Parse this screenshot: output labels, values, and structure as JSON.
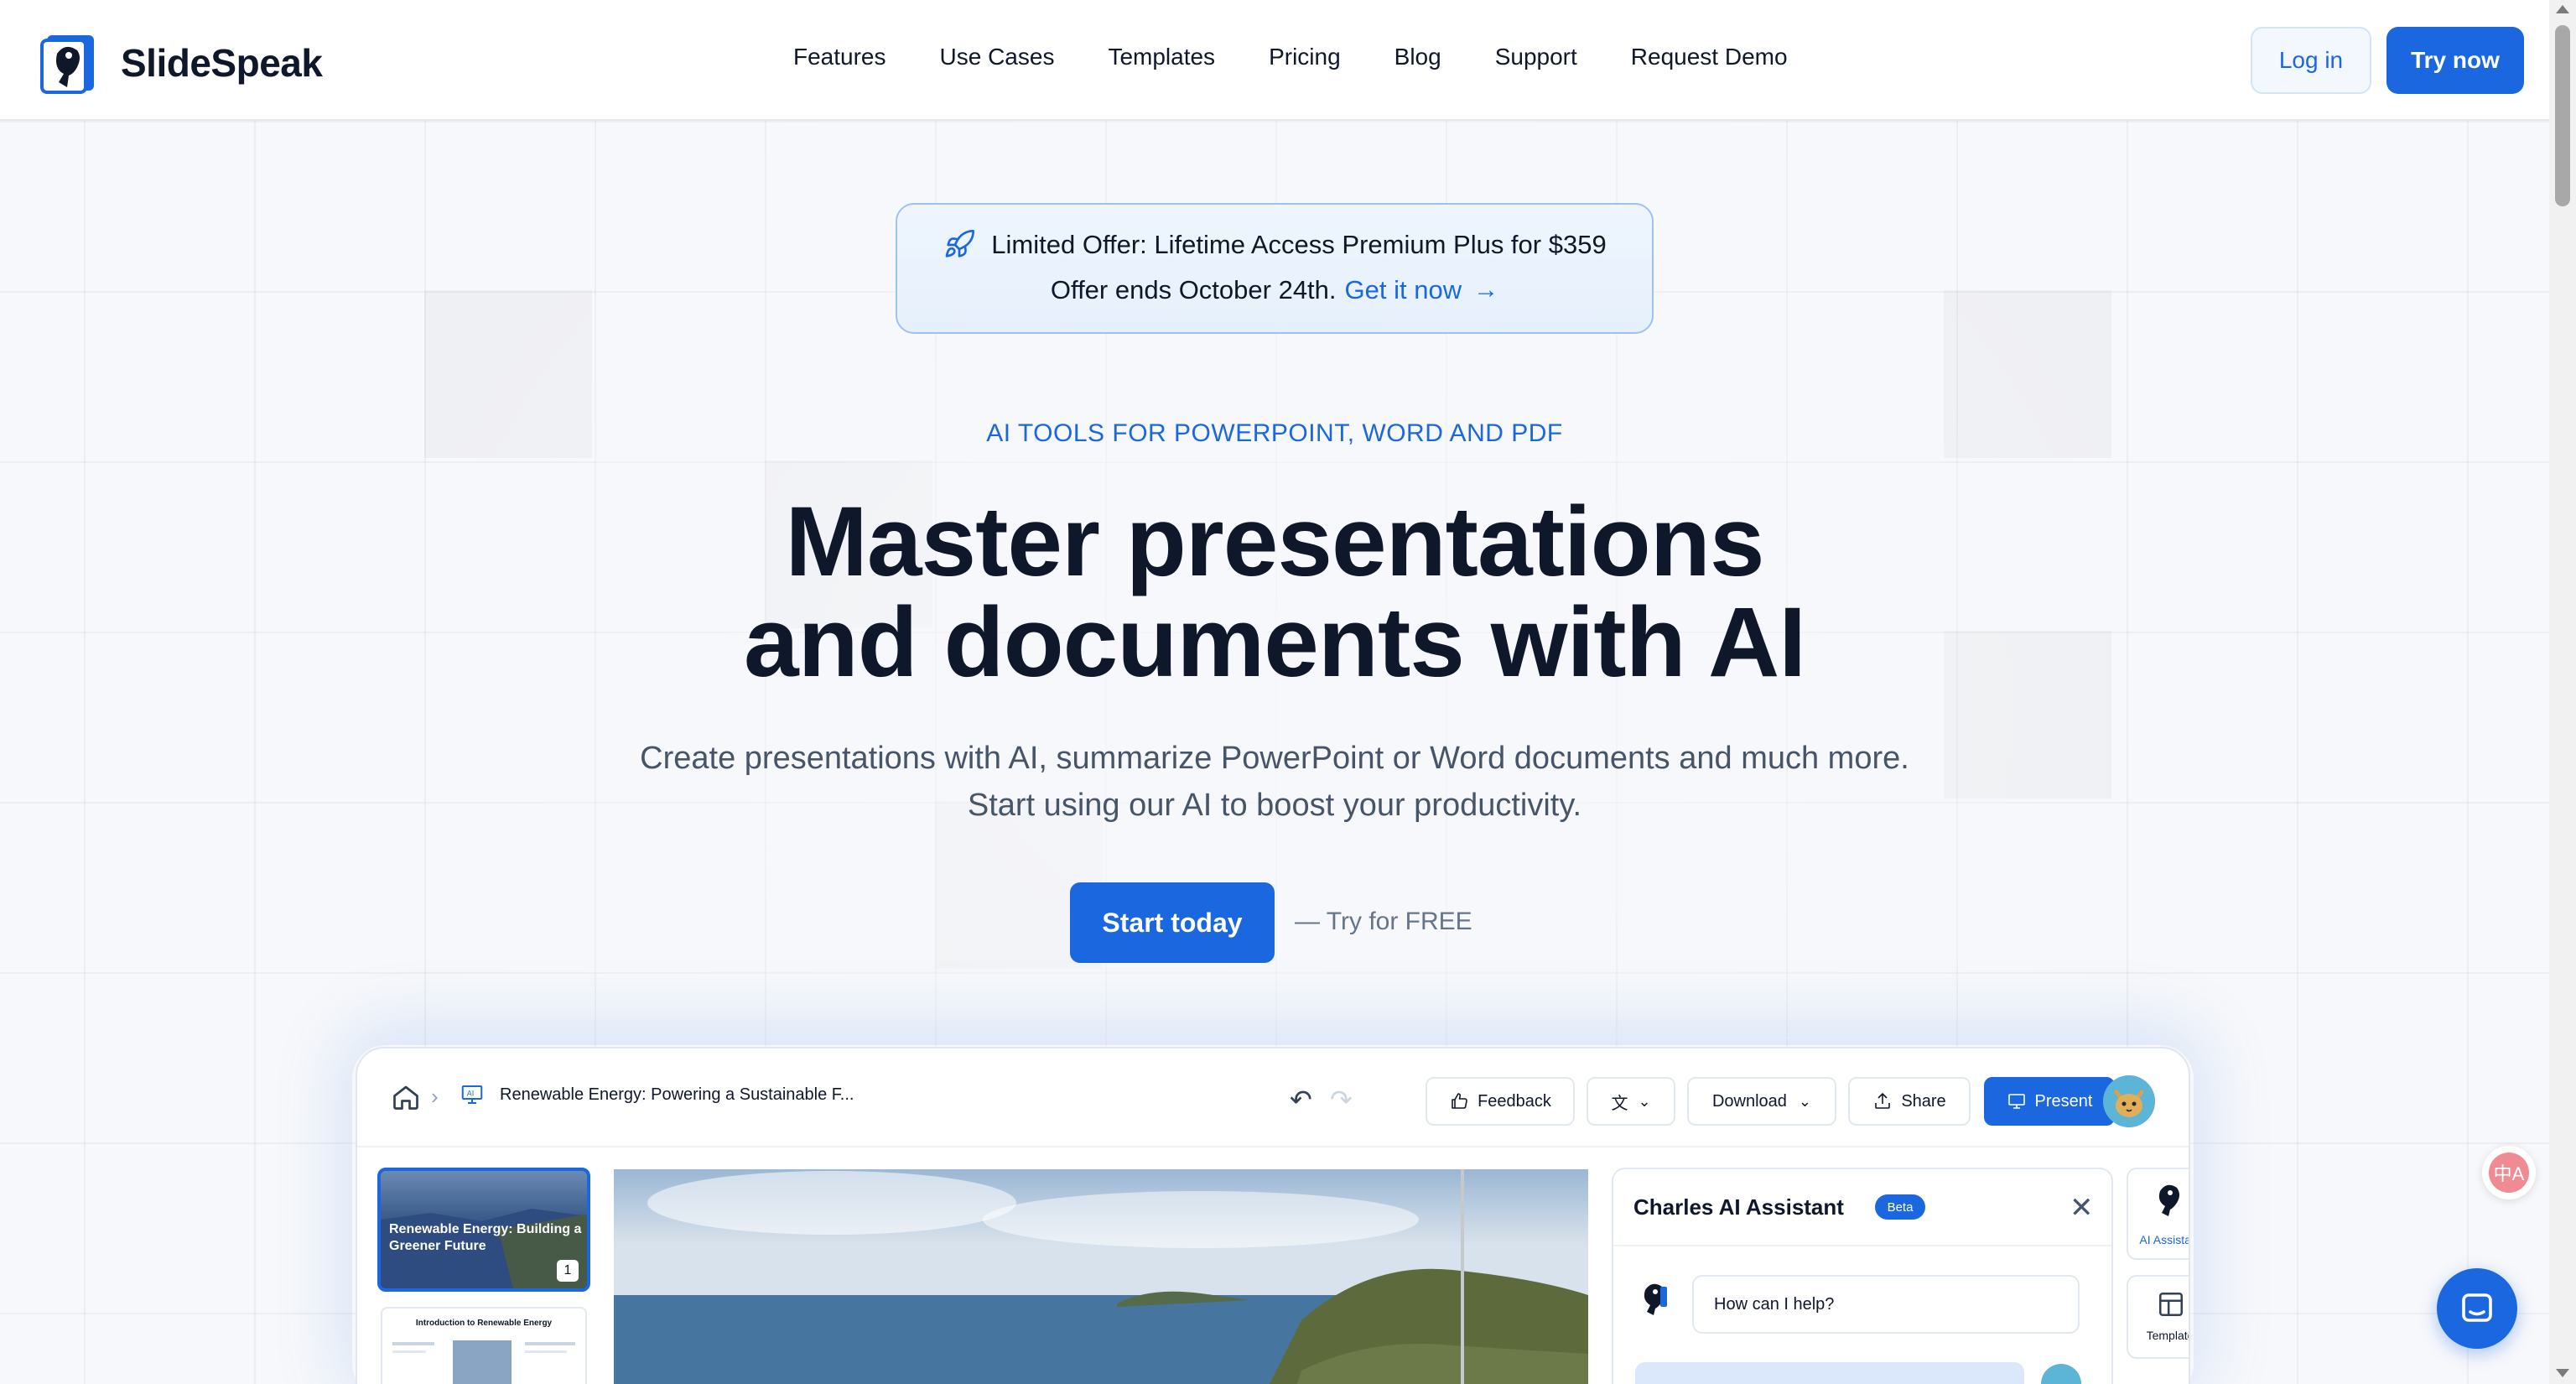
{
  "brand": {
    "name": "SlideSpeak",
    "accent": "#1a67e0"
  },
  "nav": {
    "items": [
      "Features",
      "Use Cases",
      "Templates",
      "Pricing",
      "Blog",
      "Support",
      "Request Demo"
    ]
  },
  "header": {
    "login_label": "Log in",
    "try_label": "Try now"
  },
  "offer": {
    "line1": "Limited Offer: Lifetime Access Premium Plus for $359",
    "line2": "Offer ends October 24th.",
    "link": "Get it now",
    "icon": "rocket-icon"
  },
  "hero": {
    "eyebrow": "AI TOOLS FOR POWERPOINT, WORD AND PDF",
    "headline_line1": "Master presentations",
    "headline_line2": "and documents with AI",
    "subtext": "Create presentations with AI, summarize PowerPoint or Word documents and much more. Start using our AI to boost your productivity.",
    "cta": "Start today",
    "cta_note": "— Try for FREE"
  },
  "mockup": {
    "doc_title": "Renewable Energy: Powering a Sustainable F...",
    "buttons": {
      "feedback": "Feedback",
      "download": "Download",
      "share": "Share",
      "present": "Present"
    },
    "thumb1_title": "Renewable Energy: Building a Greener Future",
    "thumb1_number": "1",
    "thumb2_title": "Introduction to Renewable Energy",
    "assistant": {
      "title": "Charles AI Assistant",
      "badge": "Beta",
      "bot_message": "How can I help?"
    },
    "side_tools": {
      "ai_assistant": "AI Assistant",
      "template": "Template"
    }
  },
  "widgets": {
    "translate_glyph": "中A"
  }
}
